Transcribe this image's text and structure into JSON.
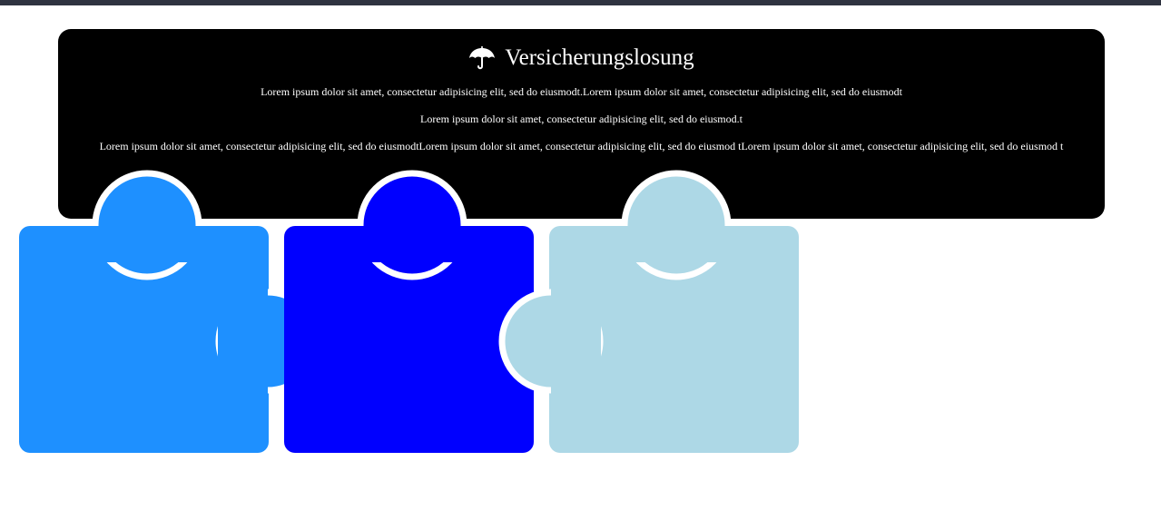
{
  "header": {
    "title": "Versicherungslosung",
    "title_icon": "umbrella-icon"
  },
  "paragraphs": [
    "Lorem ipsum dolor sit amet, consectetur adipisicing elit, sed do eiusmodt.Lorem ipsum dolor sit amet, consectetur adipisicing elit, sed do eiusmodt",
    "Lorem ipsum dolor sit amet, consectetur adipisicing elit, sed do eiusmod.t",
    "Lorem ipsum dolor sit amet, consectetur adipisicing elit, sed do eiusmodtLorem ipsum dolor sit amet, consectetur adipisicing elit, sed do eiusmod tLorem ipsum dolor sit amet, consectetur adipisicing elit, sed do eiusmod t"
  ],
  "colors": {
    "top_strip": "#2f3340",
    "card_background": "#000000",
    "card_text": "#ffffff",
    "piece_1": "#1e90ff",
    "piece_2": "#0000ff",
    "piece_3": "#add8e6"
  }
}
